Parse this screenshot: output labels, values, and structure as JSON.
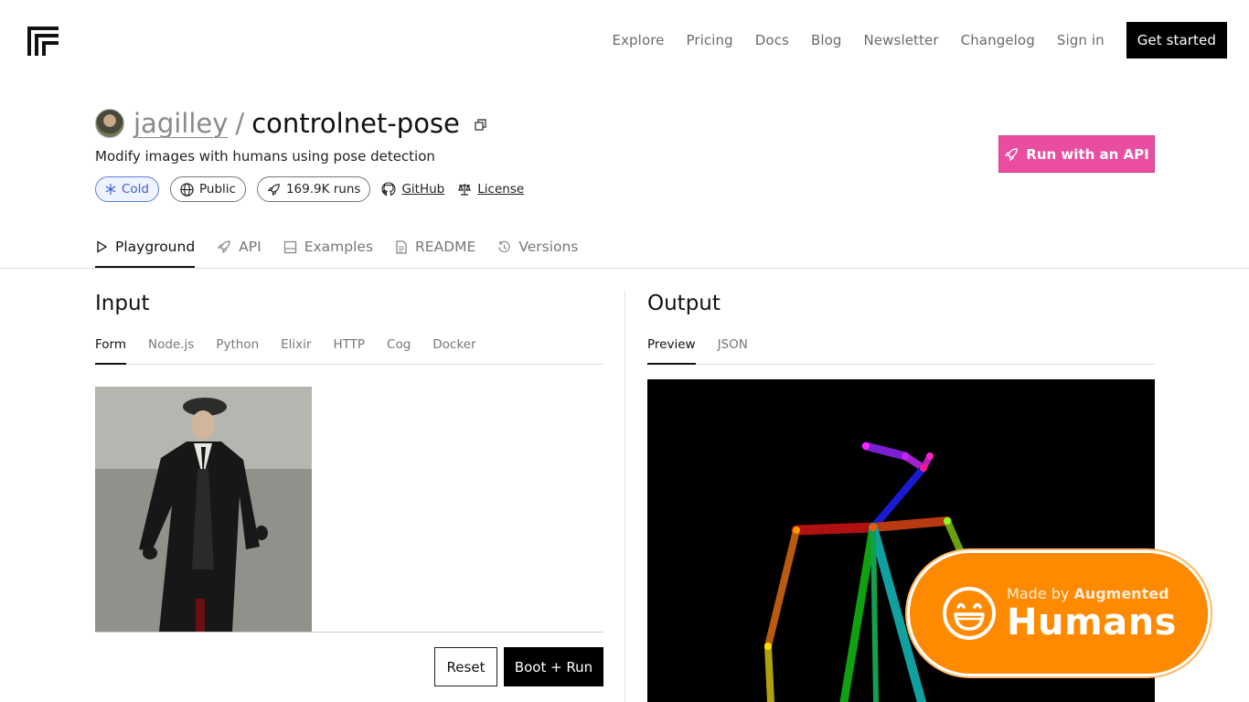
{
  "nav": {
    "links": [
      "Explore",
      "Pricing",
      "Docs",
      "Blog",
      "Newsletter",
      "Changelog",
      "Sign in"
    ],
    "cta": "Get started"
  },
  "model": {
    "owner": "jagilley",
    "separator": "/",
    "name": "controlnet-pose",
    "description": "Modify images with humans using pose detection",
    "badges": {
      "cold": "Cold",
      "visibility": "Public",
      "runs": "169.9K runs"
    },
    "links": {
      "github": "GitHub",
      "license": "License"
    },
    "api_button": "Run with an API"
  },
  "tabs": [
    "Playground",
    "API",
    "Examples",
    "README",
    "Versions"
  ],
  "input": {
    "title": "Input",
    "tabs": [
      "Form",
      "Node.js",
      "Python",
      "Elixir",
      "HTTP",
      "Cog",
      "Docker"
    ],
    "reset": "Reset",
    "run": "Boot + Run"
  },
  "output": {
    "title": "Output",
    "tabs": [
      "Preview",
      "JSON"
    ]
  },
  "overlay": {
    "made_by": "Made by",
    "brand": "Augmented",
    "word": "Humans"
  },
  "colors": {
    "accent": "#ea4c9f",
    "cold": "#3e63cc",
    "overlay": "#ff8a00"
  }
}
